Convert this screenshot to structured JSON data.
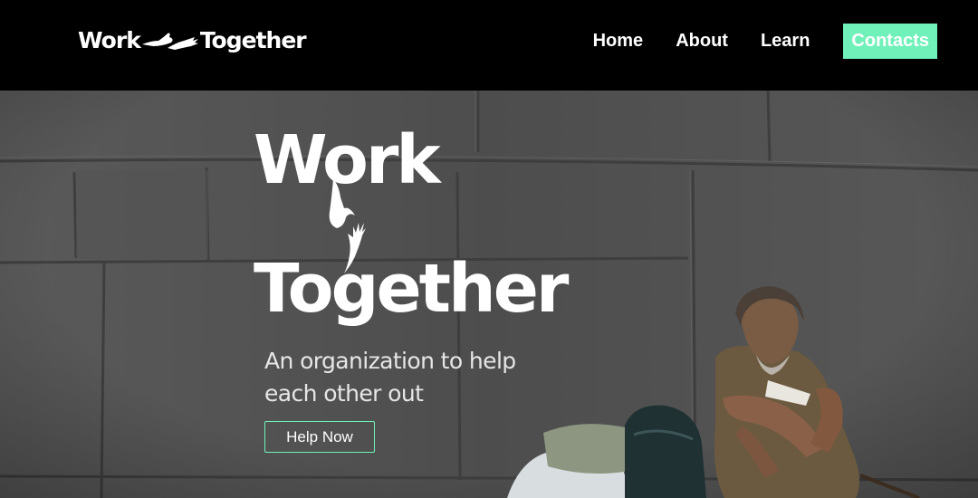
{
  "brand": {
    "name_part1": "Work",
    "name_part2": "Together",
    "accent": "#6ff1b9"
  },
  "nav": {
    "items": [
      {
        "label": "Home"
      },
      {
        "label": "About"
      },
      {
        "label": "Learn"
      },
      {
        "label": "Contacts",
        "highlighted": true
      }
    ]
  },
  "hero": {
    "title_line1": "Work",
    "title_line2": "Together",
    "tagline": "An organization to help each other out",
    "cta_label": "Help Now",
    "photo_icon": "homeless-man-sitting-against-wall-photo"
  }
}
